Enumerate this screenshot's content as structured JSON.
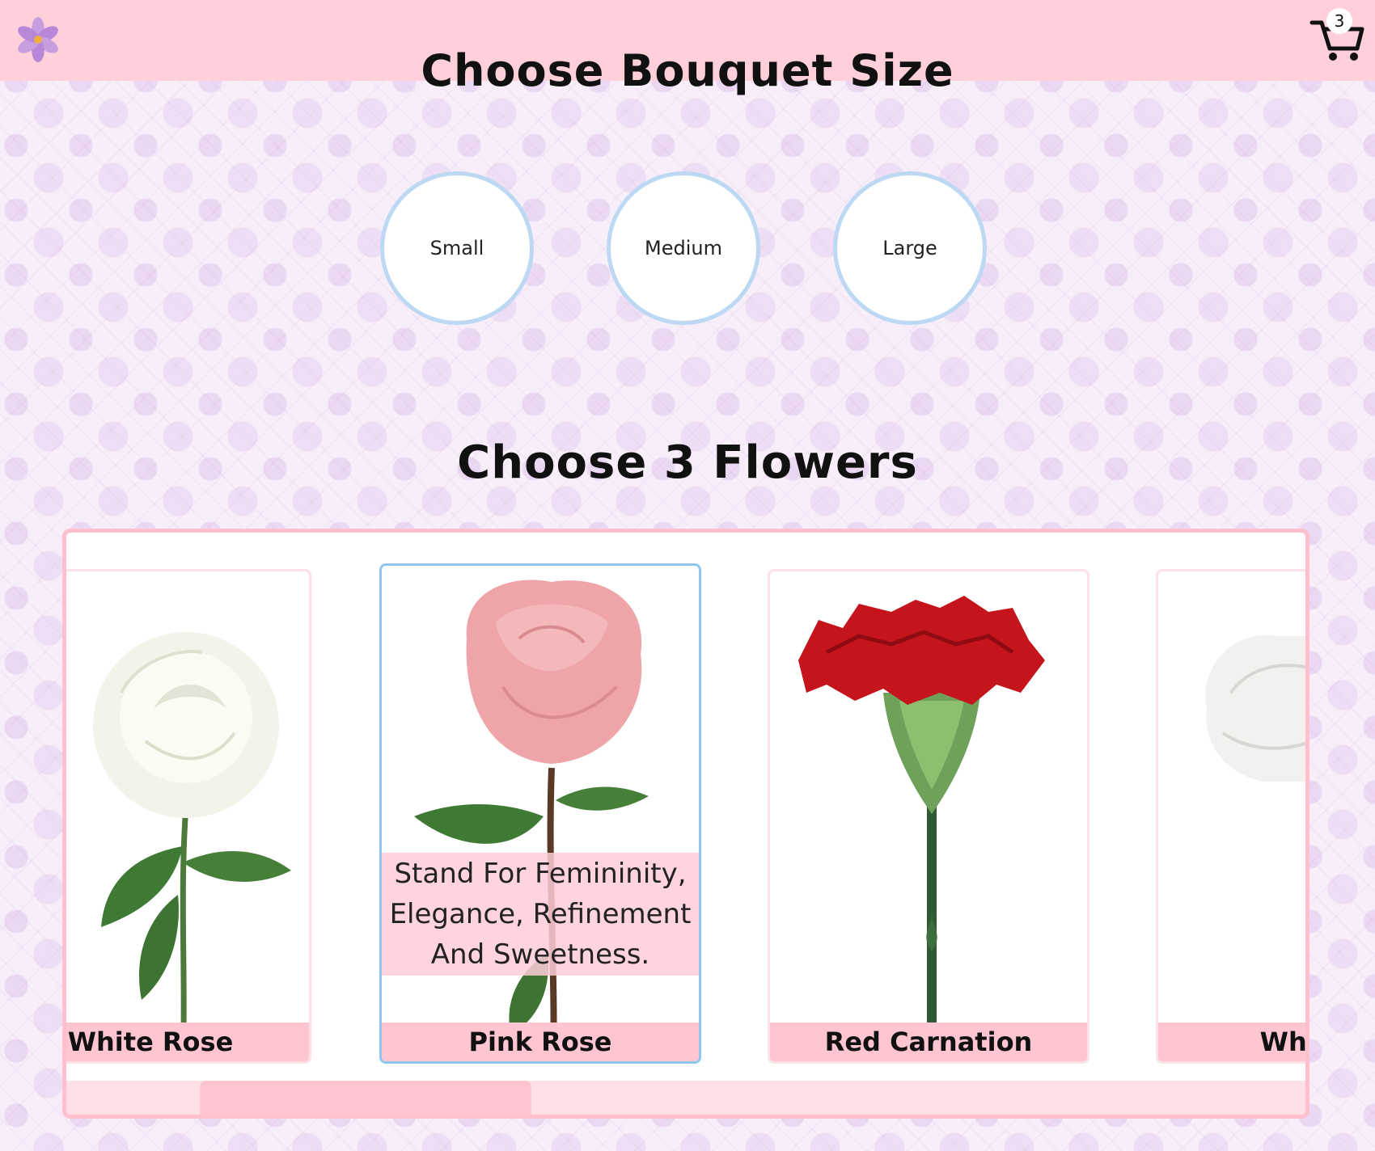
{
  "header": {
    "cart_count": "3"
  },
  "sections": {
    "size_title": "Choose Bouquet Size",
    "flowers_title": "Choose 3 Flowers"
  },
  "sizes": [
    "Small",
    "Medium",
    "Large"
  ],
  "flowers": [
    {
      "name": "White Rose"
    },
    {
      "name": "Pink Rose",
      "description": "Stand For Femininity, Elegance, Refinement And Sweetness.",
      "selected": true
    },
    {
      "name": "Red Carnation"
    },
    {
      "name": "White C"
    }
  ],
  "colors": {
    "header_bg": "#ffd0da",
    "card_border": "#ffbfcc",
    "selected_border": "#8fc6f0",
    "size_border": "#bcd8f2"
  }
}
